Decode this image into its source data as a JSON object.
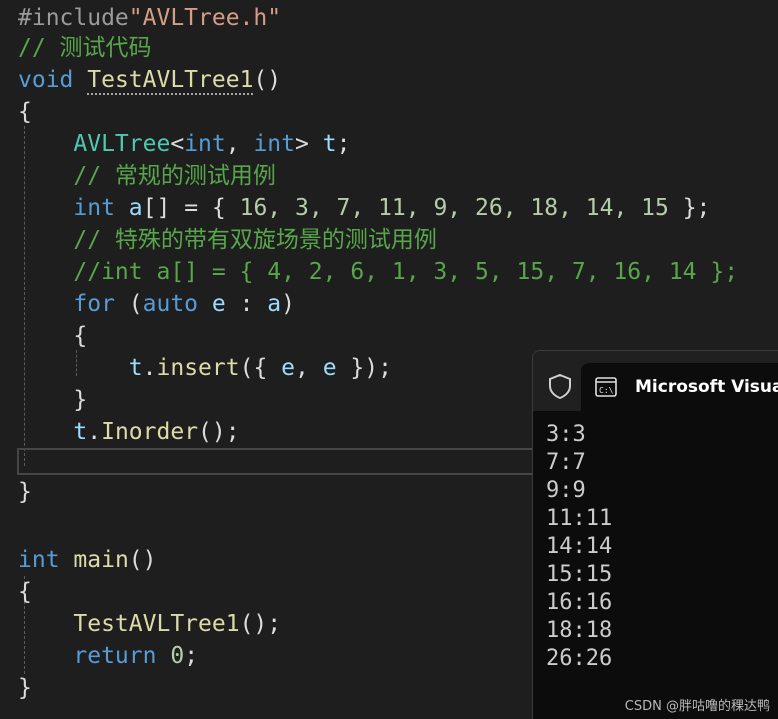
{
  "editor": {
    "include_directive": "#include",
    "include_file": "\"AVLTree.h\"",
    "comment_test_code": "// 测试代码",
    "kw_void": "void",
    "test_fn_name": "TestAVLTree1",
    "parens": "()",
    "brace_open": "{",
    "brace_close": "}",
    "avl_type": "AVLTree",
    "template_args_open": "<",
    "kw_int": "int",
    "comma": ", ",
    "template_args_close": ">",
    "var_t": "t",
    "semicolon": ";",
    "comment_normal": "// 常规的测试用例",
    "var_a": "a",
    "array_decl_rest": "[] = { ",
    "array_values": "16, 3, 7, 11, 9, 26, 18, 14, 15",
    "array_close": " };",
    "comment_special": "// 特殊的带有双旋场景的测试用例",
    "commented_array": "//int a[] = { 4, 2, 6, 1, 3, 5, 15, 7, 16, 14 };",
    "kw_for": "for",
    "for_open": " (",
    "kw_auto": "auto",
    "var_e": "e",
    "for_colon": " : ",
    "for_close": ")",
    "dot": ".",
    "fn_insert": "insert",
    "insert_open": "({ ",
    "insert_close": " });",
    "fn_inorder": "Inorder",
    "call_close": "();",
    "fn_main": "main",
    "kw_return": "return",
    "num_zero": "0"
  },
  "console": {
    "title": "Microsoft Visual S",
    "output_lines": [
      "3:3",
      "7:7",
      "9:9",
      "11:11",
      "14:14",
      "15:15",
      "16:16",
      "18:18",
      "26:26"
    ]
  },
  "watermark": "CSDN @胖咕噜的稞达鸭",
  "colors": {
    "background": "#1e1e1e",
    "keyword": "#569cd6",
    "type": "#4ec9b0",
    "function": "#dcdcaa",
    "variable": "#9cdcfe",
    "number": "#b5cea8",
    "string": "#d69d85",
    "comment": "#57a64a",
    "console_bg": "#0c0c0c"
  },
  "icons": [
    "shield-icon",
    "terminal-icon"
  ]
}
